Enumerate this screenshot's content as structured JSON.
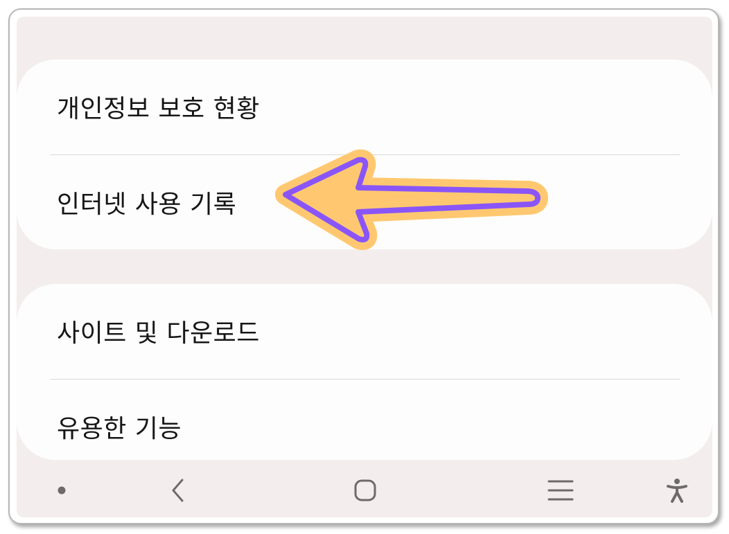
{
  "settings_groups": [
    {
      "items": [
        {
          "label": "개인정보 보호 현황"
        },
        {
          "label": "인터넷 사용 기록"
        }
      ]
    },
    {
      "items": [
        {
          "label": "사이트 및 다운로드"
        },
        {
          "label": "유용한 기능"
        }
      ]
    }
  ],
  "annotation": {
    "arrow_fill": "#ffc870",
    "arrow_outline": "#8a55f7",
    "points_to": "인터넷 사용 기록"
  },
  "navbar": {
    "buttons": [
      "dot-icon",
      "back-icon",
      "home-icon",
      "recents-icon",
      "accessibility-icon"
    ],
    "icon_color": "#6e6a6a"
  }
}
